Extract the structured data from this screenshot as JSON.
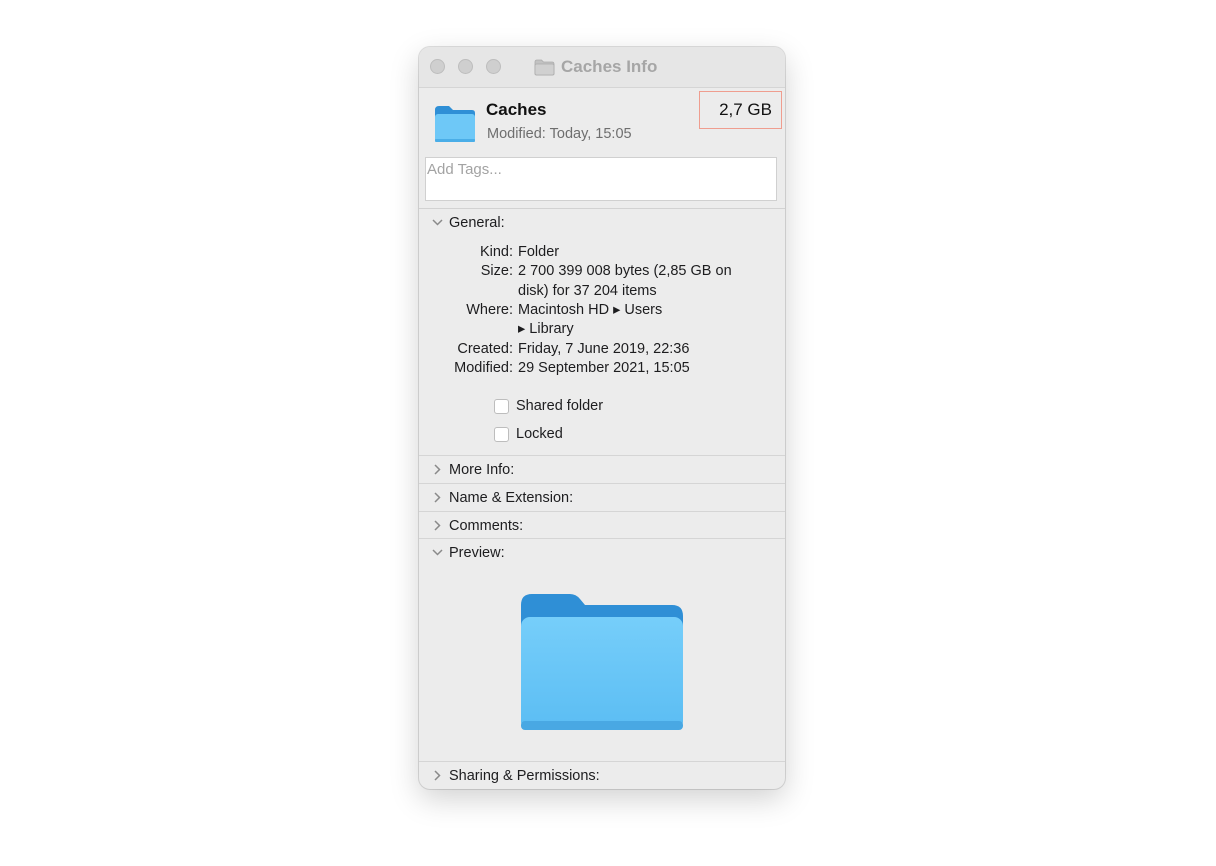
{
  "window": {
    "title": "Caches Info"
  },
  "header": {
    "name": "Caches",
    "modified_label": "Modified:",
    "modified_value": "Today, 15:05",
    "size": "2,7 GB"
  },
  "tags": {
    "placeholder": "Add Tags..."
  },
  "general": {
    "title": "General:",
    "kind_label": "Kind:",
    "kind_value": "Folder",
    "size_label": "Size:",
    "size_value_line1": "2 700 399 008 bytes (2,85 GB on",
    "size_value_line2": "disk) for 37 204 items",
    "where_label": "Where:",
    "where_value_line1": "Macintosh HD ▸ Users",
    "where_value_line2": "▸ Library",
    "created_label": "Created:",
    "created_value": "Friday, 7 June 2019, 22:36",
    "modified_label": "Modified:",
    "modified_value": "29 September 2021, 15:05",
    "shared_folder_label": "Shared folder",
    "locked_label": "Locked"
  },
  "sections": {
    "more_info": "More Info:",
    "name_extension": "Name & Extension:",
    "comments": "Comments:",
    "preview": "Preview:",
    "sharing_permissions": "Sharing & Permissions:"
  },
  "icons": {
    "title_folder": "folder-icon",
    "header_folder": "folder-icon",
    "preview_folder": "folder-icon",
    "collapse": "chevron-down-icon",
    "expand": "chevron-right-icon"
  },
  "colors": {
    "folder_front": "#6ec8f7",
    "folder_back": "#2f8fd6",
    "highlight_border": "#ef9d8f"
  }
}
